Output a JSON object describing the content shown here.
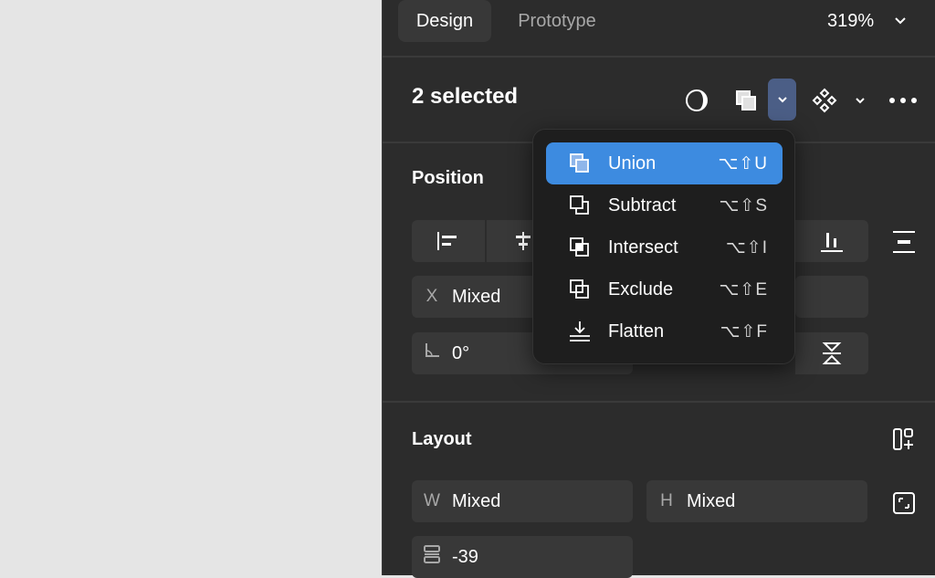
{
  "header": {
    "tabs": [
      {
        "label": "Design"
      },
      {
        "label": "Prototype"
      }
    ],
    "zoom": "319%"
  },
  "selection": {
    "title": "2 selected"
  },
  "position": {
    "title": "Position",
    "x_label": "X",
    "x_value": "Mixed",
    "rotation_value": "0°"
  },
  "boolean_menu": {
    "items": [
      {
        "label": "Union",
        "shortcut": "⌥⇧U",
        "icon": "union-icon"
      },
      {
        "label": "Subtract",
        "shortcut": "⌥⇧S",
        "icon": "subtract-icon"
      },
      {
        "label": "Intersect",
        "shortcut": "⌥⇧I",
        "icon": "intersect-icon"
      },
      {
        "label": "Exclude",
        "shortcut": "⌥⇧E",
        "icon": "exclude-icon"
      },
      {
        "label": "Flatten",
        "shortcut": "⌥⇧F",
        "icon": "flatten-icon"
      }
    ]
  },
  "layout": {
    "title": "Layout",
    "w_label": "W",
    "w_value": "Mixed",
    "h_label": "H",
    "h_value": "Mixed",
    "gap_value": "-39"
  },
  "colors": {
    "accent": "#3d8be0",
    "panel": "#2c2c2c",
    "field": "#383838",
    "menu": "#1e1e1e"
  }
}
